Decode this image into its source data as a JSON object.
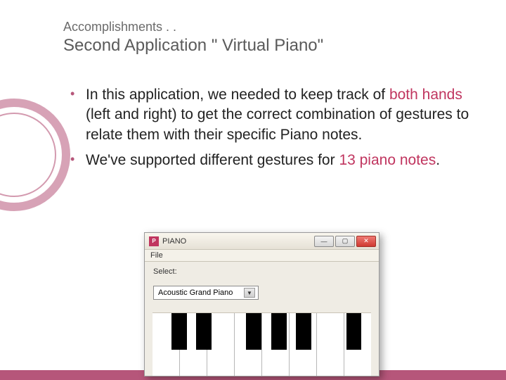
{
  "slide": {
    "kicker": "Accomplishments . .",
    "title": "Second Application \" Virtual Piano\""
  },
  "bullets": {
    "items": [
      {
        "pre": "In this application, we needed to keep track of ",
        "accent1": "both hands",
        "mid": " (left and right) to get the correct combination of gestures to relate them with their specific Piano notes.",
        "accent2": "",
        "post": ""
      },
      {
        "pre": "We've supported different gestures for ",
        "accent1": "13 piano notes",
        "mid": ".",
        "accent2": "",
        "post": ""
      }
    ]
  },
  "window": {
    "title": "PIANO",
    "menu_file": "File",
    "select_label": "Select:",
    "select_value": "Acoustic Grand Piano",
    "black_key_positions_pct": [
      8.6,
      20,
      42.9,
      54.3,
      65.7,
      88.6
    ]
  }
}
